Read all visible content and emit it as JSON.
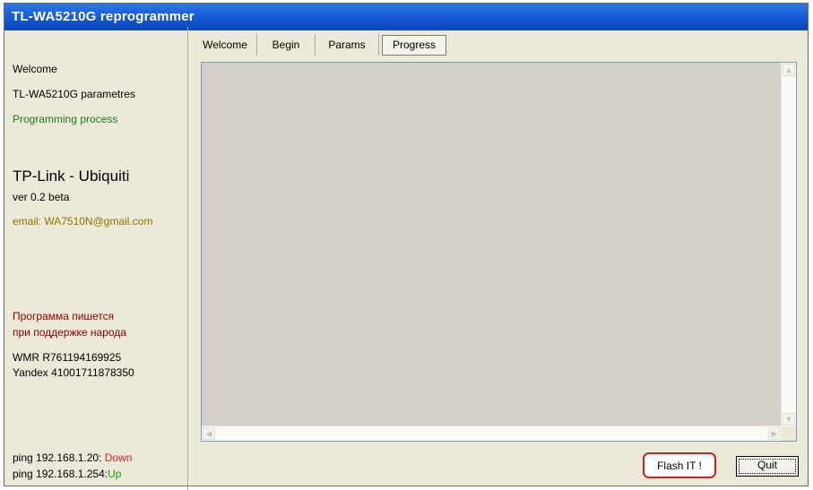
{
  "window": {
    "title": "TL-WA5210G reprogrammer"
  },
  "sidebar": {
    "items": [
      {
        "label": "Welcome"
      },
      {
        "label": "TL-WA5210G parametres"
      },
      {
        "label": "Programming process"
      }
    ],
    "app_name": "TP-Link - Ubiquiti",
    "version": "ver 0.2 beta",
    "email": "email: WA7510N@gmail.com",
    "support_line1": "Программа пишется",
    "support_line2": "при поддержке народа",
    "wmr": "WMR R761194169925",
    "yandex": "Yandex 41001711878350",
    "ping1_label": "ping 192.168.1.20:",
    "ping1_status": "Down",
    "ping2_label": "ping 192.168.1.254:",
    "ping2_status": "Up"
  },
  "tabs": [
    {
      "label": "Welcome"
    },
    {
      "label": "Begin"
    },
    {
      "label": "Params"
    },
    {
      "label": "Progress"
    }
  ],
  "active_tab": "Progress",
  "buttons": {
    "flash": "Flash IT !",
    "quit": "Quit"
  },
  "icons": {
    "scroll_up": "▲",
    "scroll_down": "▼",
    "scroll_left": "◀",
    "scroll_right": "▶"
  },
  "colors": {
    "title_bar": "#1557d4",
    "active_item": "#1f7a1f",
    "email": "#8a7400",
    "support_text": "#8b0000",
    "status_down": "#e02020",
    "status_up": "#1a9a1a",
    "highlight_ring": "#d02020"
  }
}
